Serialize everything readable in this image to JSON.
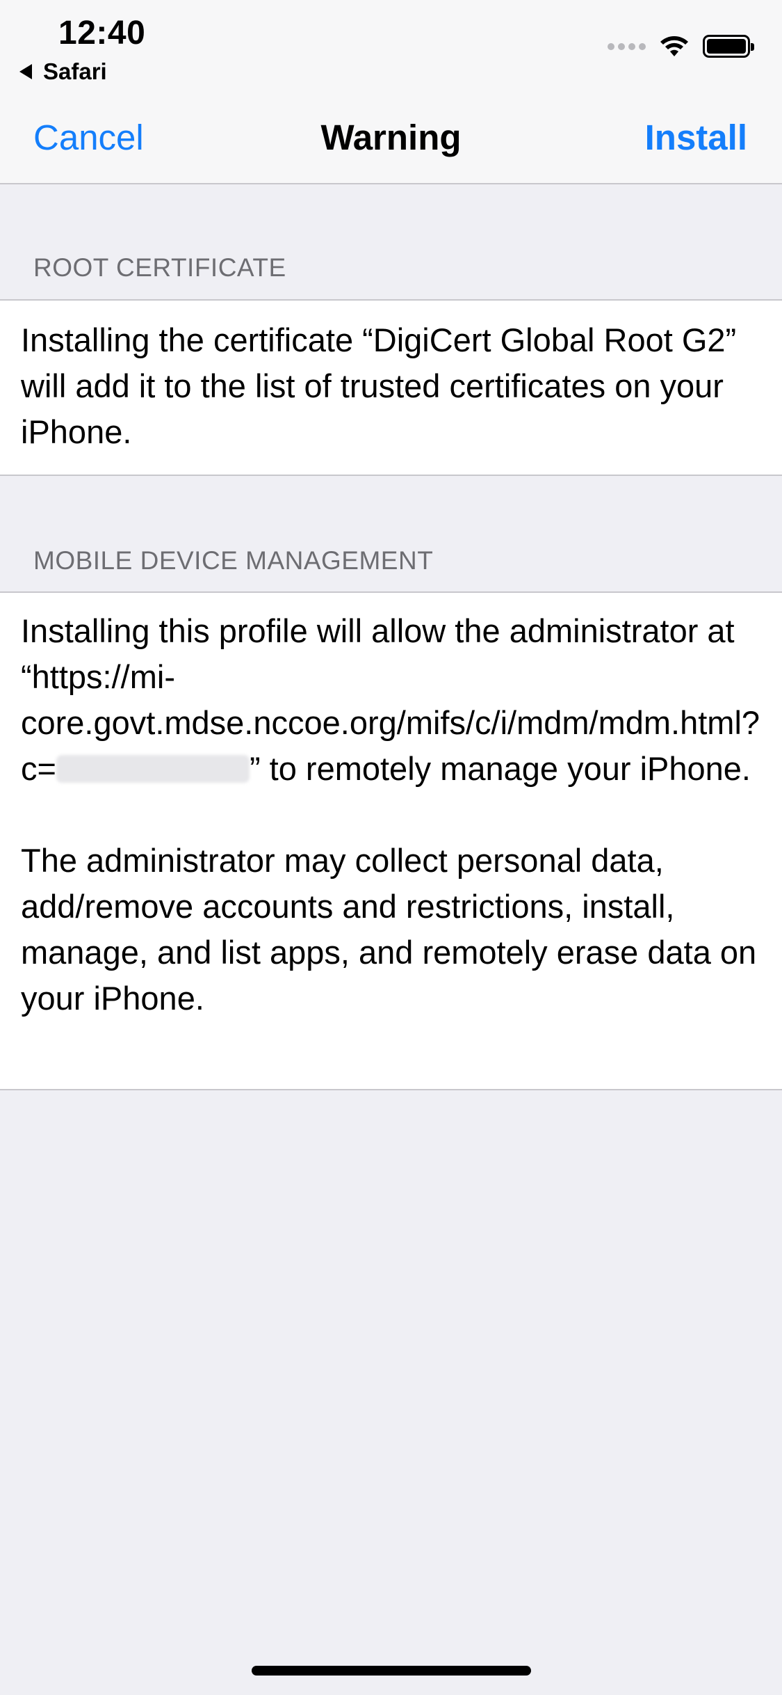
{
  "status_bar": {
    "time": "12:40",
    "back_app": "Safari",
    "icons": [
      "cellular-signal-icon",
      "wifi-icon",
      "battery-icon"
    ]
  },
  "nav": {
    "cancel_label": "Cancel",
    "title": "Warning",
    "install_label": "Install"
  },
  "sections": {
    "root_certificate": {
      "header": "ROOT CERTIFICATE",
      "body": "Installing the certificate “DigiCert Global Root G2” will add it to the list of trusted certificates on your iPhone."
    },
    "mdm": {
      "header": "MOBILE DEVICE MANAGEMENT",
      "body_before": "Installing this profile will allow the administrator at “https://mi-core.govt.mdse.nccoe.org/mifs/c/i/mdm/mdm.html?c=",
      "body_after": "” to remotely manage your iPhone.",
      "body2": "The administrator may collect personal data, add/remove accounts and restrictions, install, manage, and list apps, and remotely erase data on your iPhone."
    }
  },
  "colors": {
    "accent": "#147efb",
    "background": "#efeff4",
    "section_header": "#6d6d72",
    "separator": "#c8c7cc"
  }
}
